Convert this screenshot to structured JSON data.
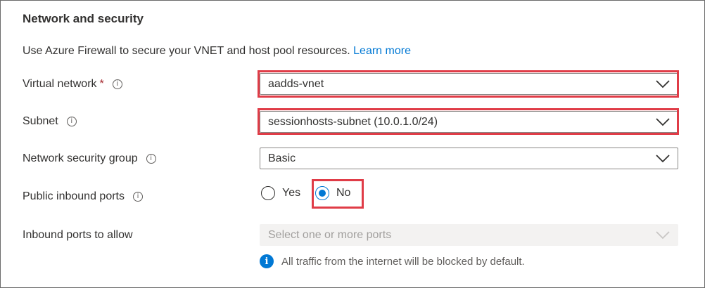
{
  "section": {
    "title": "Network and security",
    "intro_text": "Use Azure Firewall to secure your VNET and host pool resources.",
    "learn_more": "Learn more"
  },
  "fields": {
    "virtual_network": {
      "label": "Virtual network",
      "required_mark": "*",
      "value": "aadds-vnet"
    },
    "subnet": {
      "label": "Subnet",
      "value": "sessionhosts-subnet (10.0.1.0/24)"
    },
    "nsg": {
      "label": "Network security group",
      "value": "Basic"
    },
    "public_inbound_ports": {
      "label": "Public inbound ports",
      "options": [
        "Yes",
        "No"
      ],
      "selected": "No"
    },
    "inbound_ports": {
      "label": "Inbound ports to allow",
      "placeholder": "Select one or more ports",
      "note": "All traffic from the internet will be blocked by default."
    }
  },
  "icons": {
    "info": "info-icon",
    "chevron": "chevron-down-icon",
    "info_filled": "info-filled-icon"
  },
  "colors": {
    "accent": "#0078d4",
    "highlight": "#e03c47",
    "required": "#a4262c"
  }
}
